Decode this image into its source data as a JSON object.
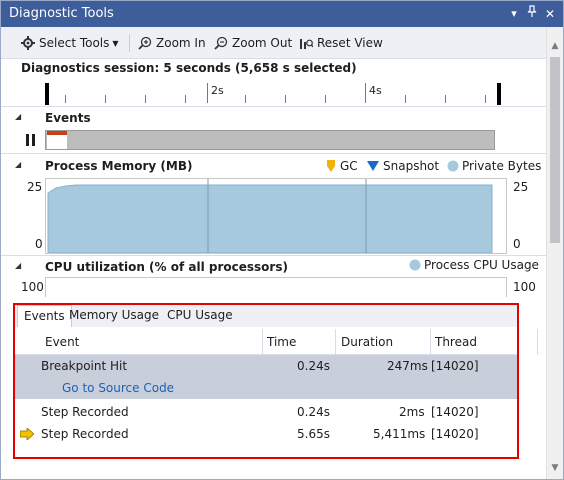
{
  "window": {
    "title": "Diagnostic Tools"
  },
  "toolbar": {
    "select_tools": "Select Tools",
    "zoom_in": "Zoom In",
    "zoom_out": "Zoom Out",
    "reset_view": "Reset View"
  },
  "session": {
    "label": "Diagnostics session: 5 seconds (5,658 s selected)"
  },
  "ruler": {
    "label_2s": "2s",
    "label_4s": "4s"
  },
  "events_section": {
    "title": "Events"
  },
  "memory_section": {
    "title": "Process Memory (MB)",
    "legend": {
      "gc": "GC",
      "snapshot": "Snapshot",
      "private_bytes": "Private Bytes"
    },
    "y_max": "25",
    "y_min": "0",
    "colors": {
      "gc": "#f2b10a",
      "snapshot": "#1b6ac9",
      "private_bytes": "#a7c9de"
    }
  },
  "cpu_section": {
    "title": "CPU utilization (% of all processors)",
    "legend": "Process CPU Usage",
    "y_max": "100"
  },
  "panel": {
    "tabs": [
      "Events",
      "Memory Usage",
      "CPU Usage"
    ],
    "columns": {
      "event": "Event",
      "time": "Time",
      "duration": "Duration",
      "thread": "Thread"
    },
    "rows": [
      {
        "event": "Breakpoint Hit",
        "time": "0.24s",
        "duration": "247ms",
        "thread": "[14020]"
      },
      {
        "link": "Go to Source Code"
      },
      {
        "event": "Step Recorded",
        "time": "0.24s",
        "duration": "2ms",
        "thread": "[14020]"
      },
      {
        "event": "Step Recorded",
        "time": "5.65s",
        "duration": "5,411ms",
        "thread": "[14020]"
      }
    ]
  }
}
